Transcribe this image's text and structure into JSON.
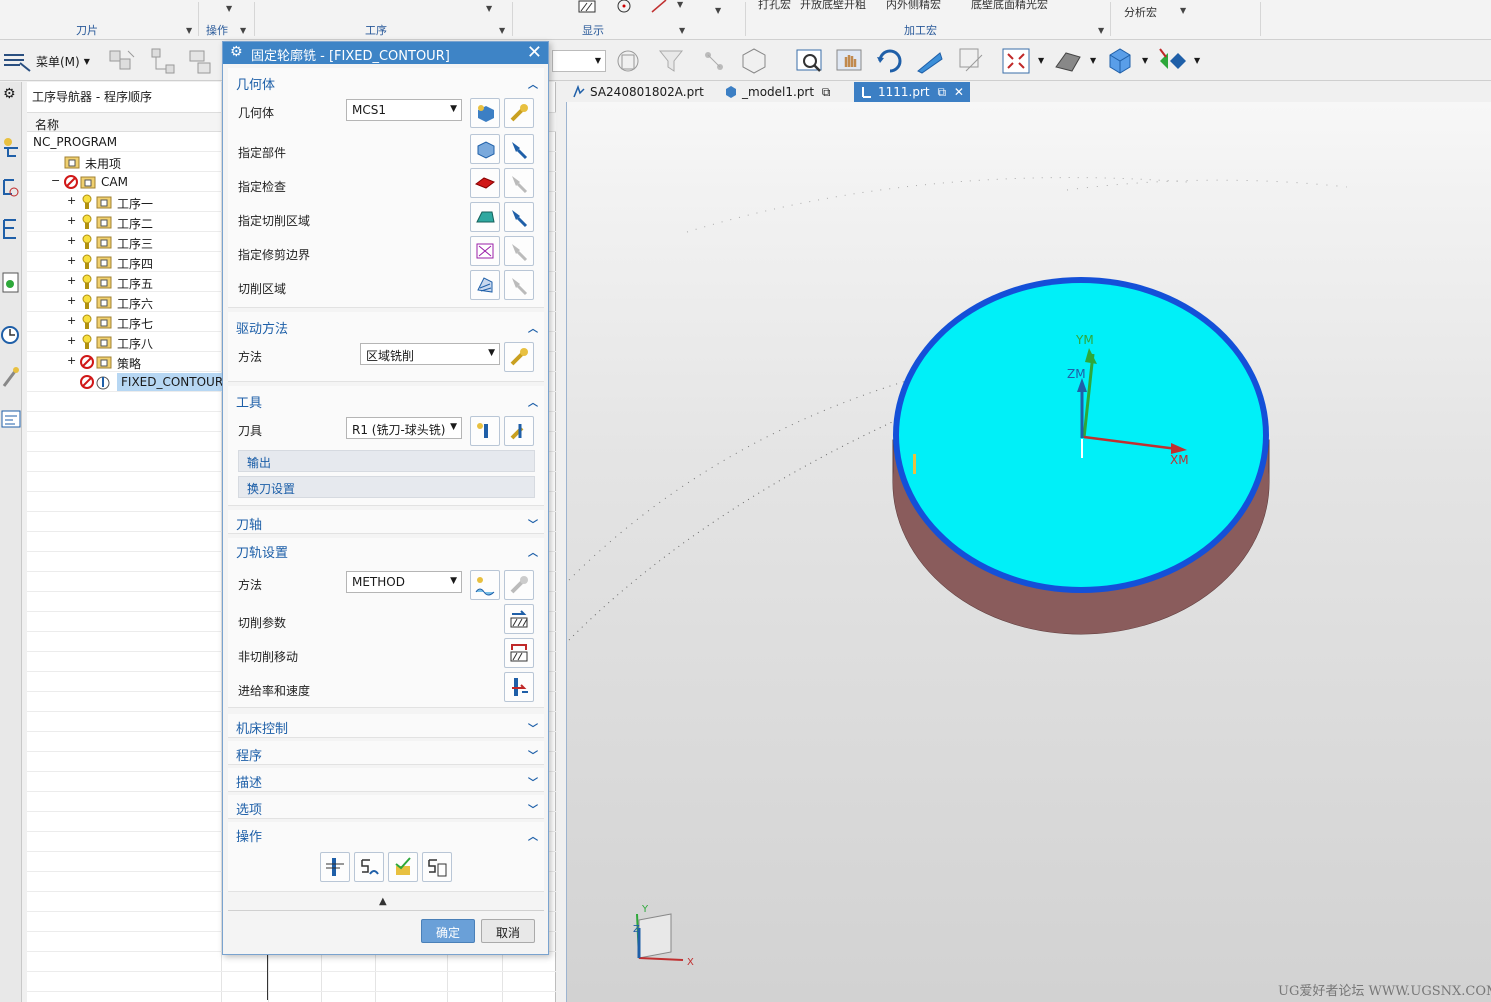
{
  "ribbon": {
    "groups": [
      "刀片",
      "操作",
      "工序",
      "显示",
      "加工宏"
    ],
    "top_items": [
      "打孔宏",
      "开放底壁开粗",
      "内外侧精宏",
      "底壁底面精光宏",
      "分析宏"
    ]
  },
  "toolbar": {
    "menu_label": "菜单(M)"
  },
  "navigator": {
    "title": "工序导航器 - 程序顺序",
    "column_name": "名称",
    "rows": [
      {
        "label": "NC_PROGRAM"
      },
      {
        "label": "未用项"
      },
      {
        "label": "CAM"
      },
      {
        "label": "工序一"
      },
      {
        "label": "工序二"
      },
      {
        "label": "工序三"
      },
      {
        "label": "工序四"
      },
      {
        "label": "工序五"
      },
      {
        "label": "工序六"
      },
      {
        "label": "工序七"
      },
      {
        "label": "工序八"
      },
      {
        "label": "策略"
      },
      {
        "label": "FIXED_CONTOUR"
      }
    ]
  },
  "tabs": [
    {
      "label": "SA240801802A.prt"
    },
    {
      "label": "_model1.prt"
    },
    {
      "label": "1111.prt"
    }
  ],
  "dialog": {
    "title": "固定轮廓铣 - [FIXED_CONTOUR]",
    "geometry": {
      "header": "几何体",
      "geometry_label": "几何体",
      "geometry_value": "MCS1",
      "part_label": "指定部件",
      "check_label": "指定检查",
      "cut_area_label": "指定切削区域",
      "trim_label": "指定修剪边界",
      "cut_region_label": "切削区域"
    },
    "drive": {
      "header": "驱动方法",
      "method_label": "方法",
      "method_value": "区域铣削"
    },
    "tool": {
      "header": "工具",
      "tool_label": "刀具",
      "tool_value": "R1 (铣刀-球头铣)",
      "output": "输出",
      "tool_change": "换刀设置"
    },
    "axis": {
      "header": "刀轴"
    },
    "path": {
      "header": "刀轨设置",
      "method_label": "方法",
      "method_value": "METHOD",
      "cut_params": "切削参数",
      "non_cut": "非切削移动",
      "feeds": "进给率和速度"
    },
    "collapsed": [
      "机床控制",
      "程序",
      "描述",
      "选项"
    ],
    "actions": {
      "header": "操作"
    },
    "ok": "确定",
    "cancel": "取消"
  },
  "viewport": {
    "axis_labels": {
      "ym": "YM",
      "zm": "ZM",
      "xm": "XM"
    },
    "triad": {
      "x": "X",
      "y": "Y",
      "z": "Z"
    },
    "watermark": "UG爱好者论坛 WWW.UGSNX.COM"
  },
  "colors": {
    "accent": "#3e84c6",
    "part_top": "#00f0f8",
    "part_side": "#8a5c5c",
    "part_rim": "#1450d8"
  }
}
